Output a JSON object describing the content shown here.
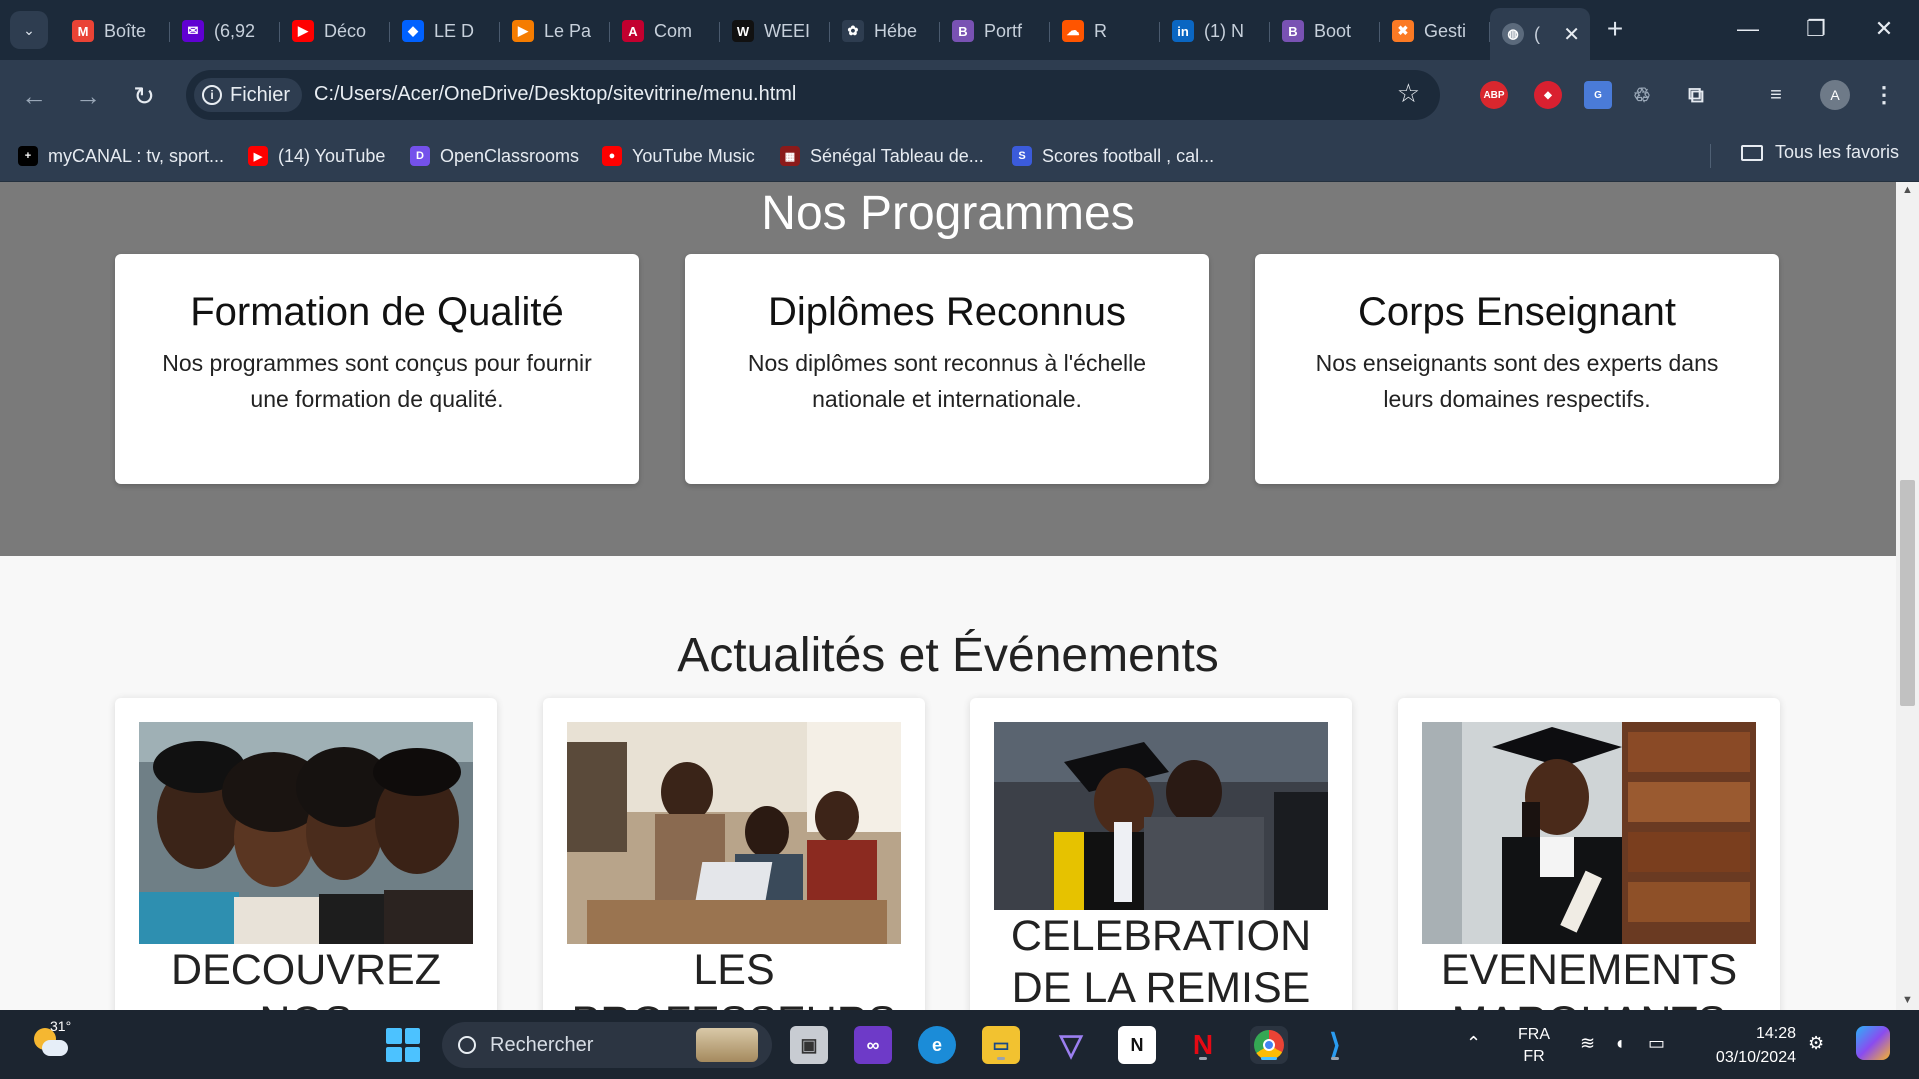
{
  "browser": {
    "tabs": [
      {
        "title": "Boîte",
        "icon": "gmail-icon",
        "color": "#ea4335",
        "glyph": "M"
      },
      {
        "title": "(6,92",
        "icon": "yahoo-mail-icon",
        "color": "#6001d2",
        "glyph": "✉"
      },
      {
        "title": "Déco",
        "icon": "youtube-icon",
        "color": "#ff0000",
        "glyph": "▶"
      },
      {
        "title": "LE D",
        "icon": "dropbox-icon",
        "color": "#0061ff",
        "glyph": "◆"
      },
      {
        "title": "Le Pa",
        "icon": "play-icon",
        "color": "#f57c00",
        "glyph": "▶"
      },
      {
        "title": "Com",
        "icon": "angular-icon",
        "color": "#c3002f",
        "glyph": "A"
      },
      {
        "title": "WEEI",
        "icon": "w-icon",
        "color": "#111111",
        "glyph": "W"
      },
      {
        "title": "Hébe",
        "icon": "openai-icon",
        "color": "#2e3d50",
        "glyph": "✿"
      },
      {
        "title": "Portf",
        "icon": "bootstrap-icon",
        "color": "#7952b3",
        "glyph": "B"
      },
      {
        "title": "R",
        "icon": "soundcloud-icon",
        "color": "#ff5500",
        "glyph": "☁"
      },
      {
        "title": "(1) N",
        "icon": "linkedin-icon",
        "color": "#0a66c2",
        "glyph": "in"
      },
      {
        "title": "Boot",
        "icon": "bootstrap-icon",
        "color": "#7952b3",
        "glyph": "B"
      },
      {
        "title": "Gesti",
        "icon": "xampp-icon",
        "color": "#fb7a24",
        "glyph": "✖"
      }
    ],
    "active_tab_title": "(",
    "address": {
      "scheme_label": "Fichier",
      "url": "C:/Users/Acer/OneDrive/Desktop/sitevitrine/menu.html"
    },
    "profile_initial": "A",
    "extensions": [
      {
        "label": "ABP",
        "color": "#d9272e"
      },
      {
        "label": "◆",
        "color": "#d92030"
      },
      {
        "label": "G",
        "color": "#4a7bd8"
      }
    ],
    "bookmarks": [
      {
        "label": "myCANAL : tv, sport...",
        "color": "#000000",
        "glyph": "+"
      },
      {
        "label": "(14) YouTube",
        "color": "#ff0000",
        "glyph": "▶"
      },
      {
        "label": "OpenClassrooms",
        "color": "#7451eb",
        "glyph": "D"
      },
      {
        "label": "YouTube Music",
        "color": "#ff0000",
        "glyph": "●"
      },
      {
        "label": "Sénégal Tableau de...",
        "color": "#8b1a1a",
        "glyph": "▦"
      },
      {
        "label": "Scores football , cal...",
        "color": "#3b5bdb",
        "glyph": "S"
      }
    ],
    "all_bookmarks_label": "Tous les favoris"
  },
  "page": {
    "programs": {
      "title": "Nos Programmes",
      "cards": [
        {
          "title": "Formation de Qualité",
          "text": "Nos programmes sont conçus pour fournir une formation de qualité."
        },
        {
          "title": "Diplômes Reconnus",
          "text": "Nos diplômes sont reconnus à l'échelle nationale et internationale."
        },
        {
          "title": "Corps Enseignant",
          "text": "Nos enseignants sont des experts dans leurs domaines respectifs."
        }
      ]
    },
    "news": {
      "title": "Actualités et Événements",
      "cards": [
        {
          "caption": "DECOUVREZ NOS",
          "image": "students-group-photo"
        },
        {
          "caption": "LES PROFESSEURS",
          "image": "classroom-photo"
        },
        {
          "caption": "CELEBRATION DE LA REMISE",
          "image": "graduation-hug-photo"
        },
        {
          "caption": "EVENEMENTS MARQUANTS",
          "image": "graduate-library-photo"
        }
      ]
    }
  },
  "taskbar": {
    "weather_temp": "31°",
    "search_placeholder": "Rechercher",
    "language_top": "FRA",
    "language_bottom": "FR",
    "time": "14:28",
    "date": "03/10/2024"
  }
}
